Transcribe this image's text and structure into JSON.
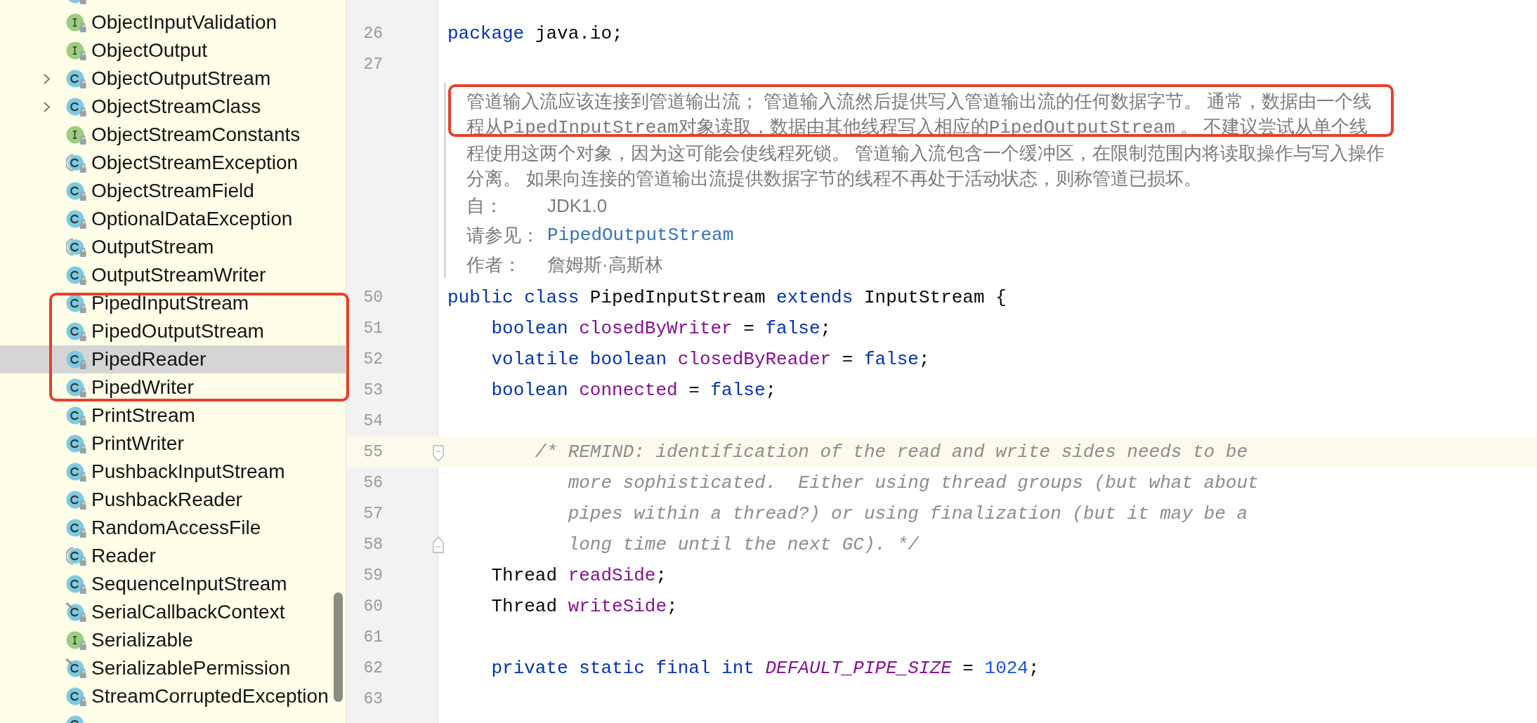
{
  "project_tree": {
    "items": [
      {
        "kind": "class",
        "expandable": false,
        "selected": false,
        "annotated": false
      },
      {
        "name": "ObjectInputValidation",
        "kind": "interface",
        "expandable": false,
        "selected": false,
        "annotated": false
      },
      {
        "name": "ObjectOutput",
        "kind": "interface",
        "expandable": false,
        "selected": false,
        "annotated": false
      },
      {
        "name": "ObjectOutputStream",
        "kind": "class",
        "expandable": true,
        "selected": false,
        "annotated": false
      },
      {
        "name": "ObjectStreamClass",
        "kind": "class",
        "expandable": true,
        "selected": false,
        "annotated": false
      },
      {
        "name": "ObjectStreamConstants",
        "kind": "interface",
        "expandable": false,
        "selected": false,
        "annotated": false
      },
      {
        "name": "ObjectStreamException",
        "kind": "abstract",
        "expandable": false,
        "selected": false,
        "annotated": false
      },
      {
        "name": "ObjectStreamField",
        "kind": "class",
        "expandable": false,
        "selected": false,
        "annotated": false
      },
      {
        "name": "OptionalDataException",
        "kind": "class",
        "expandable": false,
        "selected": false,
        "annotated": false
      },
      {
        "name": "OutputStream",
        "kind": "abstract",
        "expandable": false,
        "selected": false,
        "annotated": false
      },
      {
        "name": "OutputStreamWriter",
        "kind": "class",
        "expandable": false,
        "selected": false,
        "annotated": false
      },
      {
        "name": "PipedInputStream",
        "kind": "class",
        "expandable": false,
        "selected": false,
        "annotated": true
      },
      {
        "name": "PipedOutputStream",
        "kind": "class",
        "expandable": false,
        "selected": false,
        "annotated": true
      },
      {
        "name": "PipedReader",
        "kind": "class",
        "expandable": false,
        "selected": true,
        "annotated": true
      },
      {
        "name": "PipedWriter",
        "kind": "class",
        "expandable": false,
        "selected": false,
        "annotated": true
      },
      {
        "name": "PrintStream",
        "kind": "class",
        "expandable": false,
        "selected": false,
        "annotated": false
      },
      {
        "name": "PrintWriter",
        "kind": "class",
        "expandable": false,
        "selected": false,
        "annotated": false
      },
      {
        "name": "PushbackInputStream",
        "kind": "class",
        "expandable": false,
        "selected": false,
        "annotated": false
      },
      {
        "name": "PushbackReader",
        "kind": "class",
        "expandable": false,
        "selected": false,
        "annotated": false
      },
      {
        "name": "RandomAccessFile",
        "kind": "class",
        "expandable": false,
        "selected": false,
        "annotated": false
      },
      {
        "name": "Reader",
        "kind": "abstract",
        "expandable": false,
        "selected": false,
        "annotated": false
      },
      {
        "name": "SequenceInputStream",
        "kind": "class",
        "expandable": false,
        "selected": false,
        "annotated": false
      },
      {
        "name": "SerialCallbackContext",
        "kind": "final",
        "expandable": false,
        "selected": false,
        "annotated": false
      },
      {
        "name": "Serializable",
        "kind": "interface",
        "expandable": false,
        "selected": false,
        "annotated": false
      },
      {
        "name": "SerializablePermission",
        "kind": "final",
        "expandable": false,
        "selected": false,
        "annotated": false
      },
      {
        "name": "StreamCorruptedException",
        "kind": "class",
        "expandable": false,
        "selected": false,
        "annotated": false
      },
      {
        "kind": "class",
        "expandable": false,
        "selected": false,
        "annotated": false
      }
    ]
  },
  "editor": {
    "lines": [
      {
        "kind": "code",
        "current": false
      },
      {
        "kind": "code",
        "number": "26",
        "current": false,
        "tokens": [
          {
            "kind": "keyword",
            "text": "package "
          },
          {
            "kind": "plain",
            "text": "java.io;"
          }
        ]
      },
      {
        "kind": "code",
        "number": "27",
        "current": false
      },
      {
        "kind": "doc",
        "paragraph": [
          {
            "annotated": true,
            "parts": [
              {
                "kind": "text",
                "text": "管道输入流应该连接到管道输出流； 管道输入流然后提供写入管道输出流的任何数据字节。 通常，数据由一个线"
              }
            ]
          },
          {
            "annotated": true,
            "parts": [
              {
                "kind": "text",
                "text": "程从"
              },
              {
                "kind": "code",
                "text": "PipedInputStream"
              },
              {
                "kind": "text",
                "text": "对象读取，数据由其他线程写入相应的"
              },
              {
                "kind": "code",
                "text": "PipedOutputStream"
              },
              {
                "kind": "text",
                "text": " 。 不建议尝试从单个线"
              }
            ]
          },
          {
            "annotated": false,
            "parts": [
              {
                "kind": "text",
                "text": "程使用这两个对象，因为这可能会使线程死锁。 管道输入流包含一个缓冲区，在限制范围内将读取操作与写入操作"
              }
            ]
          },
          {
            "annotated": false,
            "parts": [
              {
                "kind": "text",
                "text": "分离。 如果向连接的管道输出流提供数据字节的线程不再处于活动状态，则称管道已损坏。"
              }
            ]
          }
        ],
        "tags": [
          {
            "label": "自：",
            "value": "JDK1.0",
            "kind": "text"
          },
          {
            "label": "请参见：",
            "value": "PipedOutputStream",
            "kind": "link"
          },
          {
            "label": "作者：",
            "value": "詹姆斯·高斯林",
            "kind": "text"
          }
        ]
      },
      {
        "kind": "code",
        "number": "50",
        "current": false,
        "tokens": [
          {
            "kind": "keyword",
            "text": "public class "
          },
          {
            "kind": "plain",
            "text": "PipedInputStream "
          },
          {
            "kind": "keyword",
            "text": "extends "
          },
          {
            "kind": "plain",
            "text": "InputStream {"
          }
        ]
      },
      {
        "kind": "code",
        "number": "51",
        "current": false,
        "tokens": [
          {
            "kind": "keyword",
            "text": "    boolean "
          },
          {
            "kind": "field",
            "text": "closedByWriter"
          },
          {
            "kind": "plain",
            "text": " = "
          },
          {
            "kind": "keyword",
            "text": "false"
          },
          {
            "kind": "plain",
            "text": ";"
          }
        ]
      },
      {
        "kind": "code",
        "number": "52",
        "current": false,
        "tokens": [
          {
            "kind": "keyword",
            "text": "    volatile boolean "
          },
          {
            "kind": "field",
            "text": "closedByReader"
          },
          {
            "kind": "plain",
            "text": " = "
          },
          {
            "kind": "keyword",
            "text": "false"
          },
          {
            "kind": "plain",
            "text": ";"
          }
        ]
      },
      {
        "kind": "code",
        "number": "53",
        "current": false,
        "tokens": [
          {
            "kind": "keyword",
            "text": "    boolean "
          },
          {
            "kind": "field",
            "text": "connected"
          },
          {
            "kind": "plain",
            "text": " = "
          },
          {
            "kind": "keyword",
            "text": "false"
          },
          {
            "kind": "plain",
            "text": ";"
          }
        ]
      },
      {
        "kind": "code",
        "number": "54",
        "current": false
      },
      {
        "kind": "code",
        "number": "55",
        "current": true,
        "fold": {
          "kind": "start",
          "expanded": true
        },
        "tokens": [
          {
            "kind": "comment",
            "text": "        /* REMIND: identification of the read and write sides needs to be"
          }
        ]
      },
      {
        "kind": "code",
        "number": "56",
        "current": false,
        "tokens": [
          {
            "kind": "comment",
            "text": "           more sophisticated.  Either using thread groups (but what about"
          }
        ]
      },
      {
        "kind": "code",
        "number": "57",
        "current": false,
        "tokens": [
          {
            "kind": "comment",
            "text": "           pipes within a thread?) or using finalization (but it may be a"
          }
        ]
      },
      {
        "kind": "code",
        "number": "58",
        "current": false,
        "fold": {
          "kind": "end",
          "expanded": true
        },
        "tokens": [
          {
            "kind": "comment",
            "text": "           long time until the next GC). */"
          }
        ]
      },
      {
        "kind": "code",
        "number": "59",
        "current": false,
        "tokens": [
          {
            "kind": "plain",
            "text": "    Thread "
          },
          {
            "kind": "field",
            "text": "readSide"
          },
          {
            "kind": "plain",
            "text": ";"
          }
        ]
      },
      {
        "kind": "code",
        "number": "60",
        "current": false,
        "tokens": [
          {
            "kind": "plain",
            "text": "    Thread "
          },
          {
            "kind": "field",
            "text": "writeSide"
          },
          {
            "kind": "plain",
            "text": ";"
          }
        ]
      },
      {
        "kind": "code",
        "number": "61",
        "current": false
      },
      {
        "kind": "code",
        "number": "62",
        "current": false,
        "tokens": [
          {
            "kind": "keyword",
            "text": "    private static final int "
          },
          {
            "kind": "constant",
            "text": "DEFAULT_PIPE_SIZE"
          },
          {
            "kind": "plain",
            "text": " = "
          },
          {
            "kind": "number",
            "text": "1024"
          },
          {
            "kind": "plain",
            "text": ";"
          }
        ]
      },
      {
        "kind": "code",
        "number": "63",
        "current": false
      }
    ]
  }
}
